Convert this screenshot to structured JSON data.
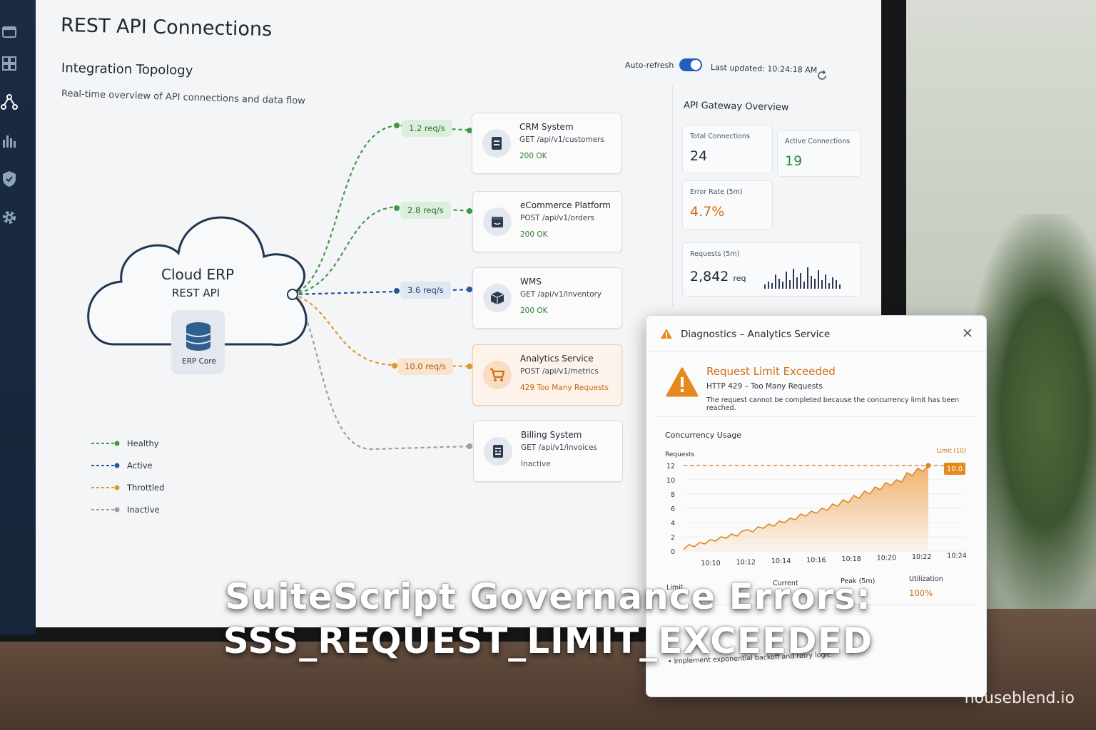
{
  "page": {
    "title": "REST API Connections",
    "auto_refresh_label": "Auto-refresh",
    "last_updated": "Last updated: 10:24:18 AM"
  },
  "sidebar": {
    "items": [
      {
        "icon": "window-icon"
      },
      {
        "icon": "dashboard-grid-icon"
      },
      {
        "icon": "network-icon"
      },
      {
        "icon": "bar-chart-icon"
      },
      {
        "icon": "shield-icon"
      },
      {
        "icon": "gear-icon"
      }
    ]
  },
  "topology": {
    "title": "Integration Topology",
    "subtitle": "Real-time overview of API connections and data flow",
    "hub_title": "Cloud ERP",
    "hub_subtitle": "REST API",
    "core_label": "ERP Core",
    "services": [
      {
        "name": "CRM System",
        "endpoint": "GET /api/v1/customers",
        "status": "200 OK",
        "rate": "1.2 req/s",
        "state": "healthy",
        "icon": "document-icon"
      },
      {
        "name": "eCommerce Platform",
        "endpoint": "POST /api/v1/orders",
        "status": "200 OK",
        "rate": "2.8 req/s",
        "state": "healthy",
        "icon": "store-icon"
      },
      {
        "name": "WMS",
        "endpoint": "GET /api/v1/inventory",
        "status": "200 OK",
        "rate": "3.6 req/s",
        "state": "active",
        "icon": "box-icon"
      },
      {
        "name": "Analytics Service",
        "endpoint": "POST /api/v1/metrics",
        "status": "429 Too Many Requests",
        "rate": "10.0 req/s",
        "state": "throttled",
        "icon": "cart-icon"
      },
      {
        "name": "Billing System",
        "endpoint": "GET /api/v1/invoices",
        "status": "Inactive",
        "rate": "",
        "state": "inactive",
        "icon": "invoice-icon"
      }
    ],
    "legend": [
      {
        "label": "Healthy",
        "color": "#3f9a48"
      },
      {
        "label": "Active",
        "color": "#24589e"
      },
      {
        "label": "Throttled",
        "color": "#e0972f"
      },
      {
        "label": "Inactive",
        "color": "#9aa0a6"
      }
    ]
  },
  "gateway": {
    "title": "API Gateway Overview",
    "total_connections_label": "Total Connections",
    "total_connections": "24",
    "active_connections_label": "Active Connections",
    "active_connections": "19",
    "error_rate_label": "Error Rate (5m)",
    "error_rate": "4.7%",
    "requests_label": "Requests (5m)",
    "requests_value": "2,842",
    "requests_unit": "req"
  },
  "diagnostics": {
    "title": "Diagnostics – Analytics Service",
    "alert_title": "Request Limit Exceeded",
    "alert_code": "HTTP 429 – Too Many Requests",
    "alert_desc": "The request cannot be completed because the concurrency limit has been reached.",
    "chart_title": "Concurrency Usage",
    "stats": {
      "limit_label": "Limit",
      "current_label": "Current",
      "peak_label": "Peak (5m)",
      "utilization_label": "Utilization",
      "utilization_value": "100%"
    },
    "recommendation": "Implement exponential backoff and retry logic."
  },
  "chart_data": {
    "type": "area",
    "ylabel": "Requests",
    "ylim": [
      0,
      12
    ],
    "yticks": [
      "0",
      "2",
      "4",
      "6",
      "8",
      "10",
      "12"
    ],
    "x_tick_labels": [
      "10:10",
      "10:12",
      "10:14",
      "10:16",
      "10:18",
      "10:20",
      "10:22",
      "10:24"
    ],
    "limit_label": "Limit (10)",
    "current_label": "10.0",
    "series": [
      {
        "values": [
          0.2,
          0.9,
          0.6,
          1.2,
          1.0,
          1.6,
          1.4,
          2.0,
          1.8,
          2.4,
          2.1,
          2.8,
          3.0,
          2.7,
          3.4,
          3.2,
          3.8,
          3.5,
          4.2,
          4.0,
          4.6,
          4.4,
          5.2,
          4.9,
          5.6,
          5.3,
          6.0,
          5.7,
          6.6,
          6.3,
          7.2,
          6.8,
          7.8,
          7.4,
          8.4,
          8.0,
          9.0,
          8.6,
          9.6,
          9.2,
          10.0,
          9.7,
          11.0,
          10.6,
          11.6,
          11.2,
          12.0
        ]
      }
    ]
  },
  "overlay_text": {
    "headline_line1": "SuiteScript Governance Errors:",
    "headline_line2": "SSS_REQUEST_LIMIT_EXCEEDED",
    "watermark": "houseblend.io"
  }
}
